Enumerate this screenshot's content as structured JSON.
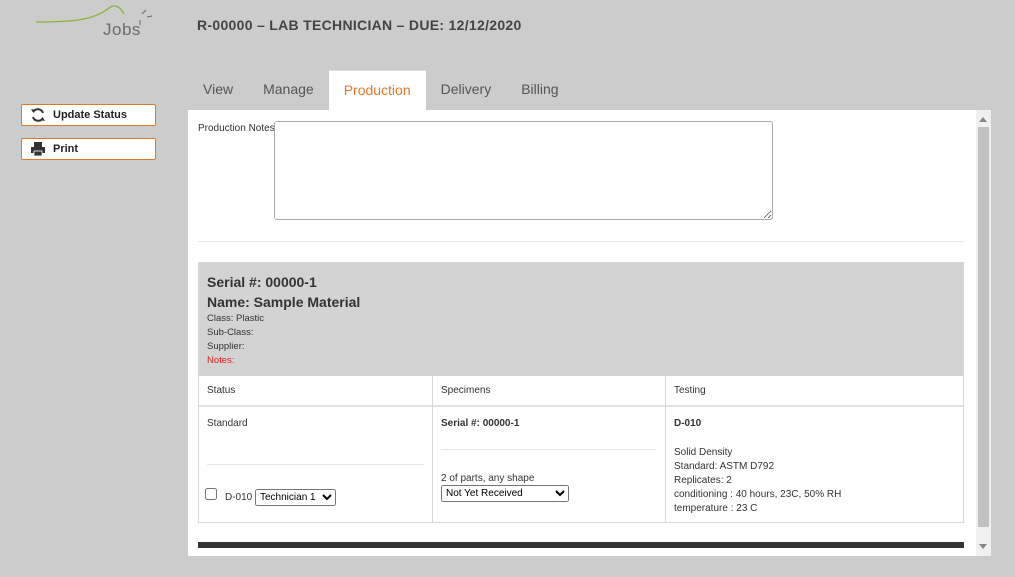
{
  "app": {
    "logo_text": "Jobs"
  },
  "header": {
    "title": "R-00000 – LAB TECHNICIAN – DUE: 12/12/2020"
  },
  "sidebar": {
    "update_status_label": "Update Status",
    "print_label": "Print"
  },
  "tabs": [
    {
      "label": "View"
    },
    {
      "label": "Manage"
    },
    {
      "label": "Production",
      "active": true
    },
    {
      "label": "Delivery"
    },
    {
      "label": "Billing"
    }
  ],
  "production": {
    "notes_label": "Production Notes",
    "notes_value": ""
  },
  "sample": {
    "serial_line": "Serial #: 00000-1",
    "name_line": "Name: Sample Material",
    "class_line": "Class: Plastic",
    "subclass_line": "Sub-Class:",
    "supplier_line": "Supplier:",
    "notes_line": "Notes:"
  },
  "columns": {
    "status_header": "Status",
    "specimens_header": "Specimens",
    "testing_header": "Testing"
  },
  "status": {
    "value": "Standard",
    "test_code": "D-010",
    "technician_selected": "Technician 1"
  },
  "specimens": {
    "serial": "Serial #: 00000-1",
    "description": "2 of parts, any shape",
    "receipt_selected": "Not Yet Received"
  },
  "testing": {
    "code": "D-010",
    "name": "Solid Density",
    "standard": "Standard: ASTM D792",
    "replicates": "Replicates: 2",
    "conditioning": "conditioning : 40 hours, 23C, 50% RH",
    "temperature": "temperature : 23 C"
  },
  "colors": {
    "accent": "#e07a2b",
    "background": "#cccccc",
    "notes_red": "#e02020",
    "logo_green": "#8bb33a"
  }
}
